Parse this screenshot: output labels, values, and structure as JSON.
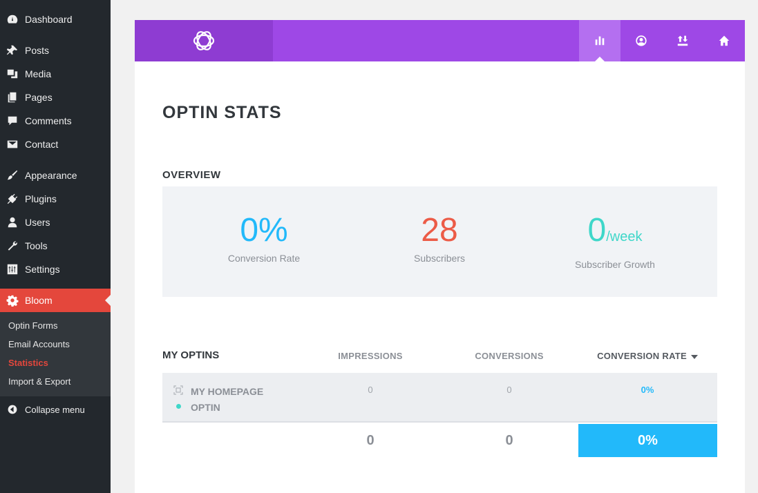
{
  "sidebar": {
    "items": [
      {
        "label": "Dashboard",
        "icon": "dashboard-icon"
      },
      {
        "label": "Posts",
        "icon": "pin-icon"
      },
      {
        "label": "Media",
        "icon": "media-icon"
      },
      {
        "label": "Pages",
        "icon": "pages-icon"
      },
      {
        "label": "Comments",
        "icon": "comment-icon"
      },
      {
        "label": "Contact",
        "icon": "envelope-icon"
      },
      {
        "label": "Appearance",
        "icon": "brush-icon"
      },
      {
        "label": "Plugins",
        "icon": "plug-icon"
      },
      {
        "label": "Users",
        "icon": "user-icon"
      },
      {
        "label": "Tools",
        "icon": "wrench-icon"
      },
      {
        "label": "Settings",
        "icon": "sliders-icon"
      },
      {
        "label": "Bloom",
        "icon": "gear-icon",
        "active": true
      }
    ],
    "submenu": [
      "Optin Forms",
      "Email Accounts",
      "Statistics",
      "Import & Export"
    ],
    "submenu_current": "Statistics",
    "collapse_label": "Collapse menu"
  },
  "topbar": {
    "buttons": [
      "stats-icon",
      "user-circle-icon",
      "import-export-icon",
      "home-icon"
    ],
    "active": "stats-icon"
  },
  "page": {
    "title": "OPTIN STATS",
    "overview_heading": "OVERVIEW"
  },
  "overview": {
    "conversion_rate": {
      "value": "0%",
      "label": "Conversion Rate",
      "color": "#22b9fa"
    },
    "subscribers": {
      "value": "28",
      "label": "Subscribers",
      "color": "#ec5b47"
    },
    "growth": {
      "value": "0",
      "unit": "/week",
      "label": "Subscriber Growth",
      "color": "#3fd7c9"
    }
  },
  "optins": {
    "heading": "MY OPTINS",
    "columns": {
      "impressions": "IMPRESSIONS",
      "conversions": "CONVERSIONS",
      "rate": "CONVERSION RATE"
    },
    "rows": [
      {
        "name_line1": "MY HOMEPAGE",
        "name_line2": "OPTIN",
        "impressions": "0",
        "conversions": "0",
        "rate": "0%",
        "status_color": "#3fd7c9"
      }
    ],
    "totals": {
      "impressions": "0",
      "conversions": "0",
      "rate": "0%"
    }
  },
  "colors": {
    "accent": "#9e48e6",
    "rate_blue": "#22b9fa",
    "wp_red": "#e4473c"
  }
}
